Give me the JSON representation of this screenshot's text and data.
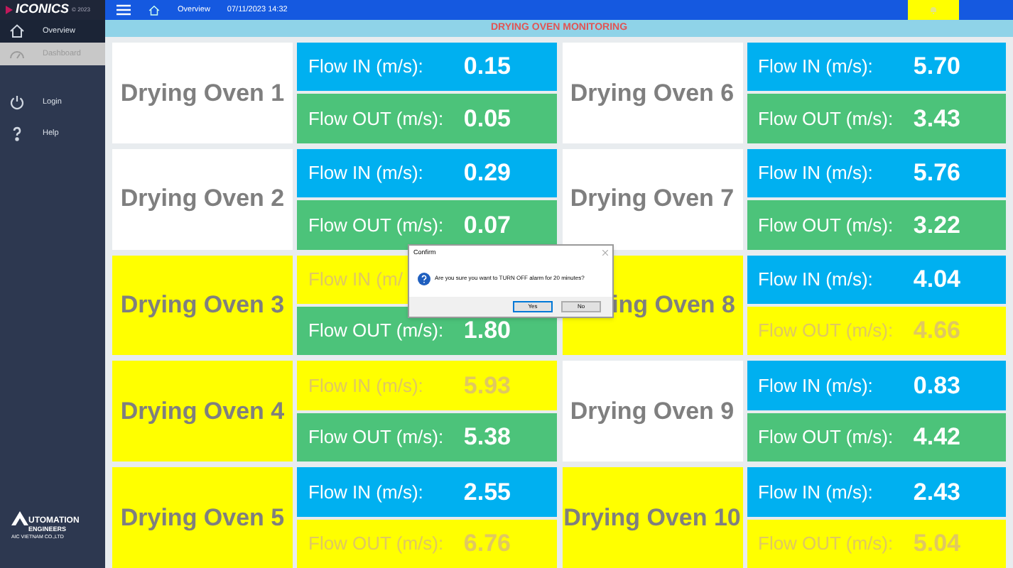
{
  "sidebar": {
    "brand": "ICONICS",
    "copyright": "© 2023",
    "items": [
      {
        "label": "Overview",
        "kind": "home",
        "selected": true,
        "disabled": false
      },
      {
        "label": "Dashboard",
        "kind": "gauge",
        "selected": false,
        "disabled": true
      },
      {
        "label": "Login",
        "kind": "power",
        "selected": false,
        "disabled": false
      },
      {
        "label": "Help",
        "kind": "help",
        "selected": false,
        "disabled": false
      }
    ],
    "footer_logo": {
      "line_1": "UTOMATION",
      "line_2": "ENGINEERS",
      "line_3": "AIC VIETNAM CO.,LTD"
    }
  },
  "top_bar": {
    "page": "Overview",
    "datetime": "07/11/2023 14:32"
  },
  "banner": "DRYING OVEN MONITORING",
  "ovens": [
    {
      "name": "Drying Oven 1",
      "alarm": false,
      "flow_in": {
        "label": "Flow IN (m/s):",
        "value": "0.15",
        "alarm": false
      },
      "flow_out": {
        "label": "Flow OUT (m/s):",
        "value": "0.05",
        "alarm": false
      }
    },
    {
      "name": "Drying Oven 6",
      "alarm": false,
      "flow_in": {
        "label": "Flow IN (m/s):",
        "value": "5.70",
        "alarm": false
      },
      "flow_out": {
        "label": "Flow OUT (m/s):",
        "value": "3.43",
        "alarm": false
      }
    },
    {
      "name": "Drying Oven 2",
      "alarm": false,
      "flow_in": {
        "label": "Flow IN (m/s):",
        "value": "0.29",
        "alarm": false
      },
      "flow_out": {
        "label": "Flow OUT (m/s):",
        "value": "0.07",
        "alarm": false
      }
    },
    {
      "name": "Drying Oven 7",
      "alarm": false,
      "flow_in": {
        "label": "Flow IN (m/s):",
        "value": "5.76",
        "alarm": false
      },
      "flow_out": {
        "label": "Flow OUT (m/s):",
        "value": "3.22",
        "alarm": false
      }
    },
    {
      "name": "Drying Oven 3",
      "alarm": true,
      "flow_in": {
        "label": "Flow IN (m/",
        "alarm": true
      },
      "flow_out": {
        "label": "Flow OUT (m/s):",
        "value": "1.80",
        "alarm": false
      }
    },
    {
      "name": "ing Oven 8",
      "alarm": true,
      "flow_in": {
        "label": "Flow IN (m/s):",
        "value": "4.04",
        "alarm": false
      },
      "flow_out": {
        "label": "Flow OUT (m/s):",
        "value": "4.66",
        "alarm": true
      }
    },
    {
      "name": "Drying Oven 4",
      "alarm": true,
      "flow_in": {
        "label": "Flow IN (m/s):",
        "value": "5.93",
        "alarm": true
      },
      "flow_out": {
        "label": "Flow OUT (m/s):",
        "value": "5.38",
        "alarm": false
      }
    },
    {
      "name": "Drying Oven 9",
      "alarm": false,
      "flow_in": {
        "label": "Flow IN (m/s):",
        "value": "0.83",
        "alarm": false
      },
      "flow_out": {
        "label": "Flow OUT (m/s):",
        "value": "4.42",
        "alarm": false
      }
    },
    {
      "name": "Drying Oven 5",
      "alarm": true,
      "flow_in": {
        "label": "Flow IN (m/s):",
        "value": "2.55",
        "alarm": false
      },
      "flow_out": {
        "label": "Flow OUT (m/s):",
        "value": "6.76",
        "alarm": true
      }
    },
    {
      "name": "Drying Oven 10",
      "alarm": true,
      "flow_in": {
        "label": "Flow IN (m/s):",
        "value": "2.43",
        "alarm": false
      },
      "flow_out": {
        "label": "Flow OUT (m/s):",
        "value": "5.04",
        "alarm": true
      }
    }
  ],
  "dialog": {
    "title": "Confirm",
    "message": "Are you sure you want to TURN OFF alarm for 20 minutes?",
    "buttons": [
      {
        "label": "Yes",
        "selected": true
      },
      {
        "label": "No",
        "selected": false
      }
    ]
  }
}
